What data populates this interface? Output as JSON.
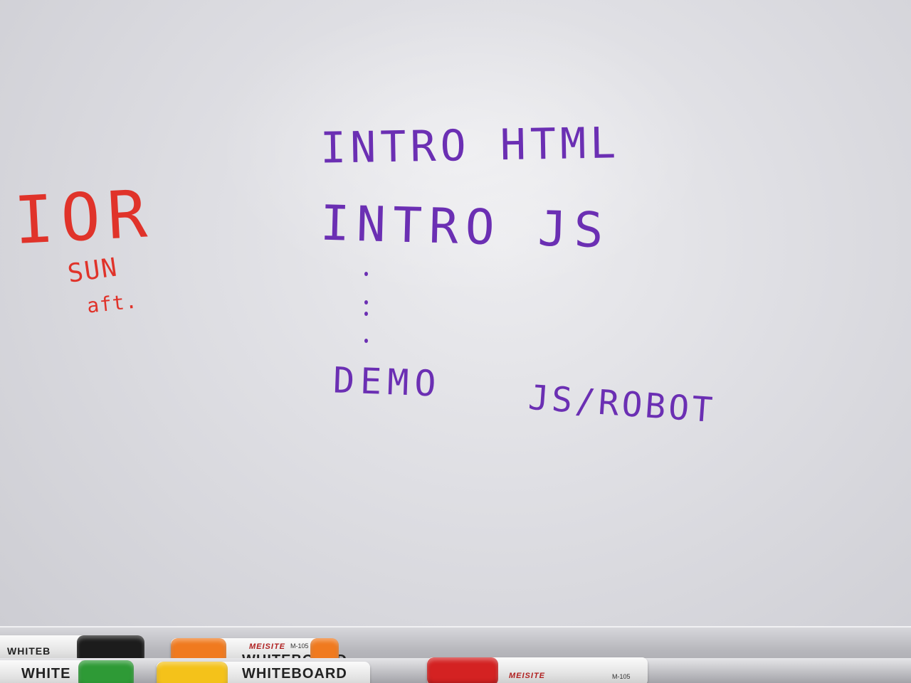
{
  "whiteboard": {
    "agenda": [
      "INTRO HTML",
      "INTRO JS",
      "DEMO",
      "JS/ROBOT"
    ],
    "side_note": {
      "title": "IOR",
      "line1": "SUN",
      "line2": "aft."
    },
    "ink_colors": {
      "agenda": "#6b2fb3",
      "side_note": "#e0332a"
    }
  },
  "tray": {
    "markers": [
      {
        "body_text": "WHITEB",
        "cap_color": "#1c1c1c"
      },
      {
        "body_text": "WHITE",
        "cap_color": "#2e9a36"
      },
      {
        "brand": "MEISITE",
        "model": "M-105",
        "body_text": "WHITEBOARD",
        "cap_color": "#f07a1f"
      },
      {
        "body_text": "WHITEBOARD",
        "cap_color": "#f4c21a"
      },
      {
        "brand": "MEISITE",
        "model": "M-105",
        "cap_color": "#d42222"
      }
    ]
  }
}
